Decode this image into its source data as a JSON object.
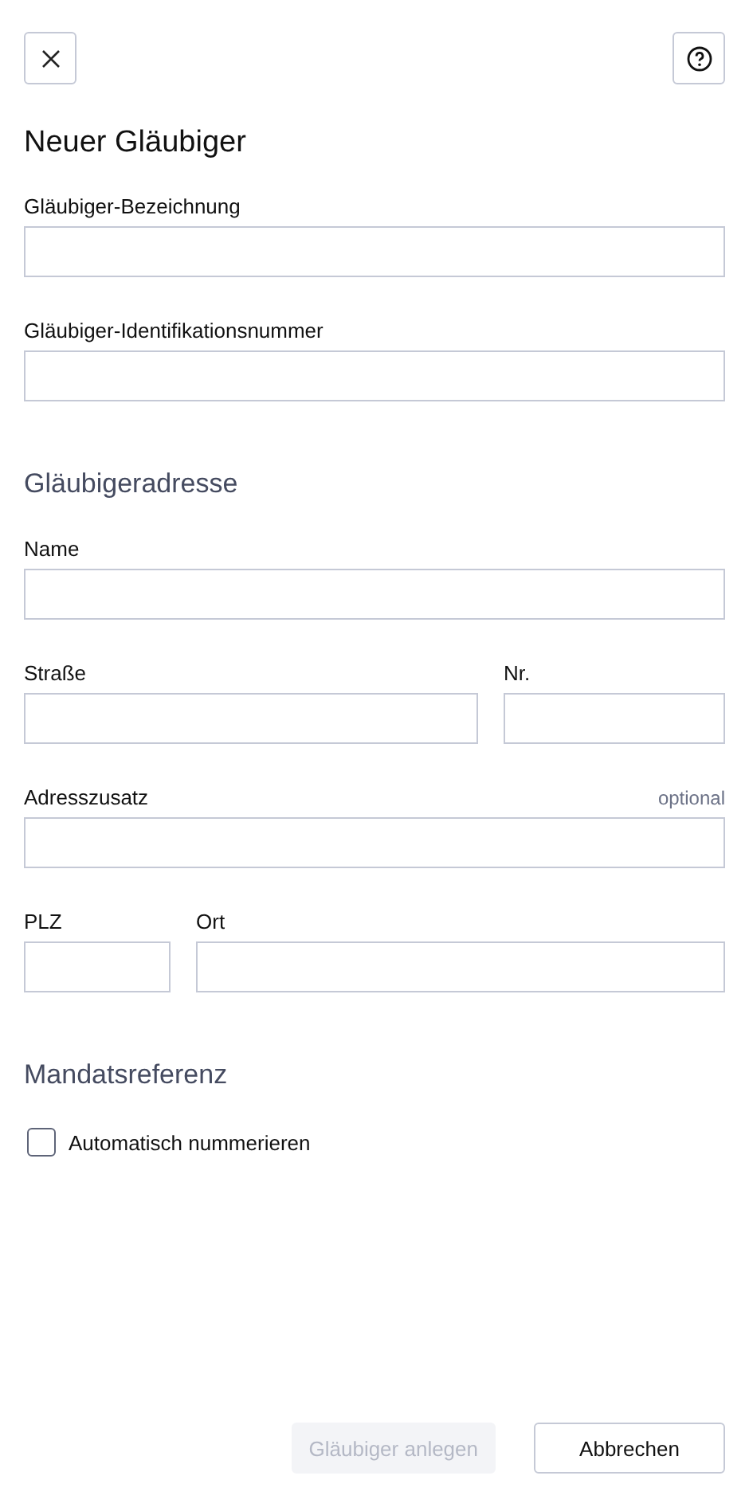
{
  "title": "Neuer Gläubiger",
  "sections": [
    {
      "rows": [
        [
          {
            "label": "Gläubiger-Bezeichnung",
            "kind": "wide"
          }
        ],
        [
          {
            "label": "Gläubiger-Identifikationsnummer",
            "kind": "wide"
          }
        ]
      ]
    },
    {
      "heading": "Gläubigeradresse",
      "rows": [
        [
          {
            "label": "Name",
            "kind": "wide"
          }
        ],
        [
          {
            "label": "Straße",
            "kind": "wide"
          },
          {
            "label": "Nr.",
            "kind": "short"
          }
        ],
        [
          {
            "label": "Adresszusatz",
            "hint": "optional",
            "kind": "wide"
          }
        ],
        [
          {
            "label": "PLZ",
            "kind": "short"
          },
          {
            "label": "Ort",
            "kind": "wide"
          }
        ]
      ]
    },
    {
      "heading": "Mandatsreferenz",
      "checkbox": {
        "label": "Automatisch nummerieren",
        "checked": false
      }
    }
  ],
  "buttons": [
    {
      "label": "Gläubiger anlegen",
      "disabled": true
    },
    {
      "label": "Abbrechen",
      "disabled": false
    }
  ]
}
